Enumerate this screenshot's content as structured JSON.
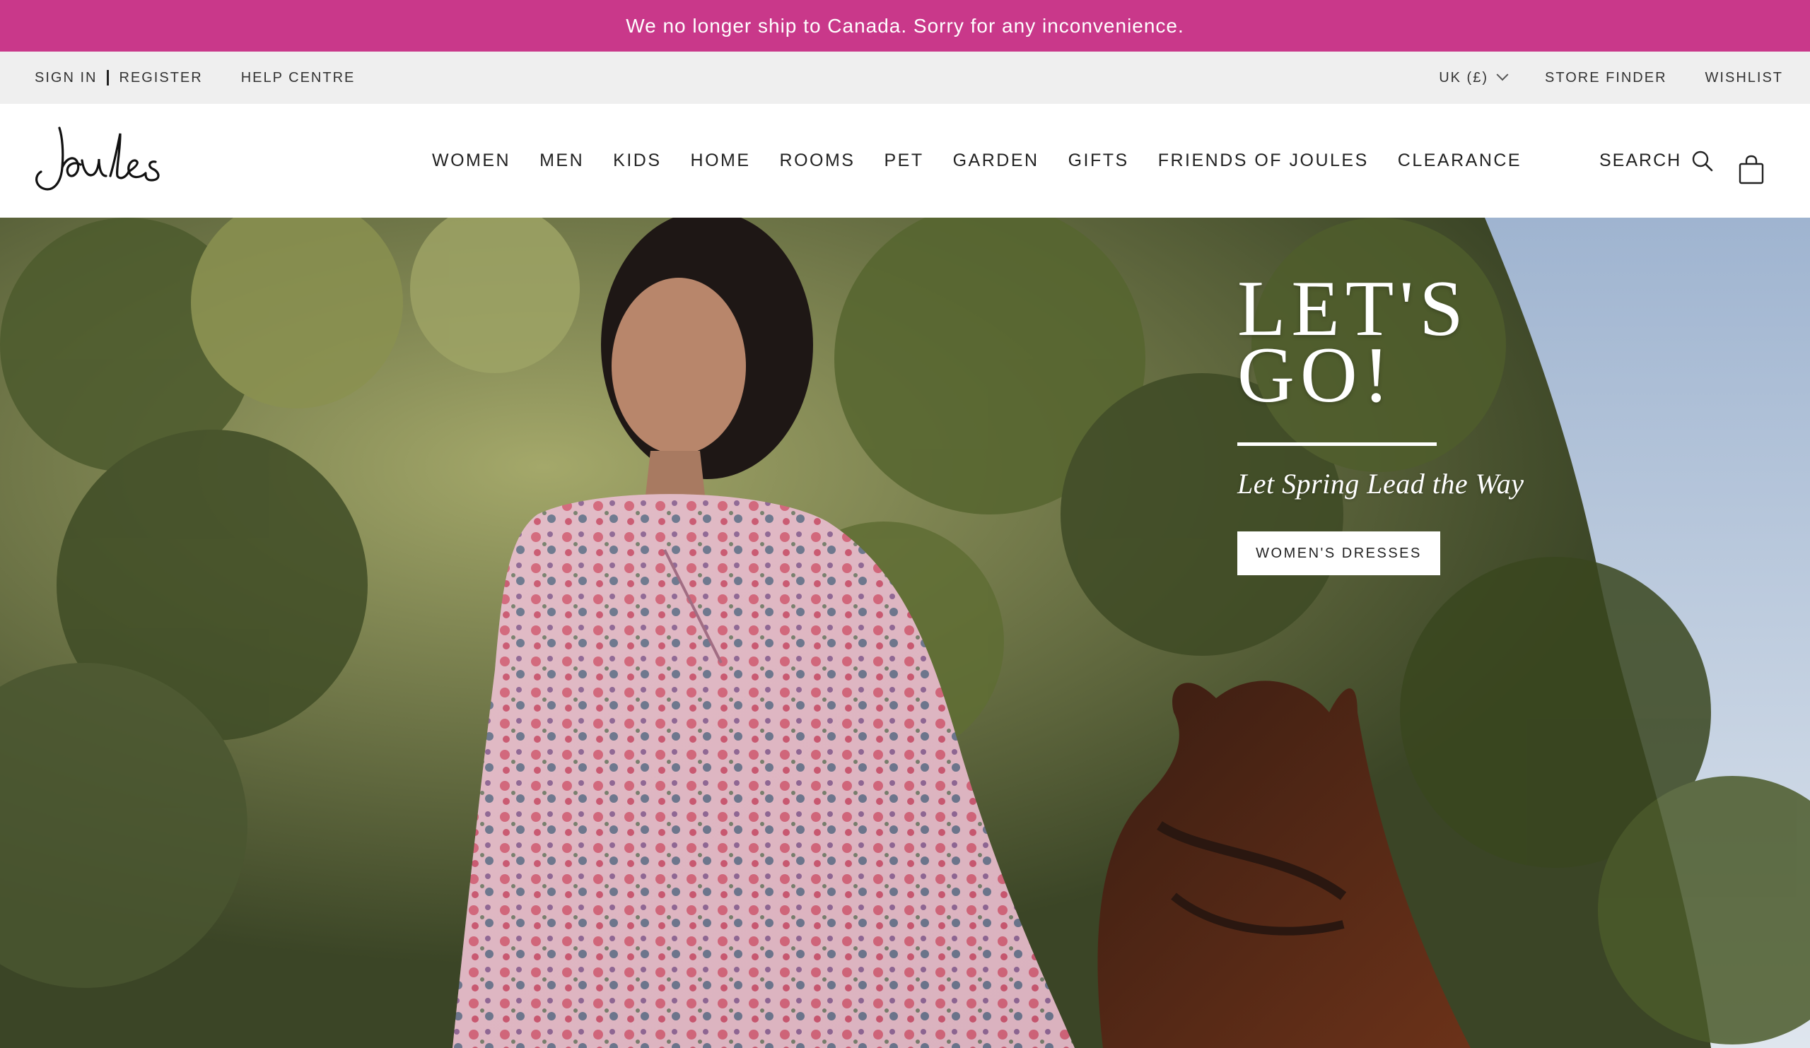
{
  "announcement": {
    "text": "We no longer ship to Canada. Sorry for any inconvenience."
  },
  "utility": {
    "sign_in": "SIGN IN",
    "register": "REGISTER",
    "help_centre": "HELP CENTRE",
    "currency": "UK (£)",
    "store_finder": "STORE FINDER",
    "wishlist": "WISHLIST"
  },
  "header": {
    "logo_text": "Joules",
    "nav": [
      "WOMEN",
      "MEN",
      "KIDS",
      "HOME",
      "ROOMS",
      "PET",
      "GARDEN",
      "GIFTS",
      "FRIENDS OF JOULES",
      "CLEARANCE"
    ],
    "search_label": "SEARCH"
  },
  "hero": {
    "headline_line1": "LET'S",
    "headline_line2": "GO!",
    "tagline": "Let Spring Lead the Way",
    "cta_label": "WOMEN'S DRESSES"
  },
  "icons": {
    "search": "search-icon",
    "bag": "shopping-bag-icon",
    "currency_dropdown": "chevron-down-icon"
  },
  "colors": {
    "announcement_bg": "#c9388a",
    "utility_bg": "#efefef",
    "text": "#222222"
  }
}
